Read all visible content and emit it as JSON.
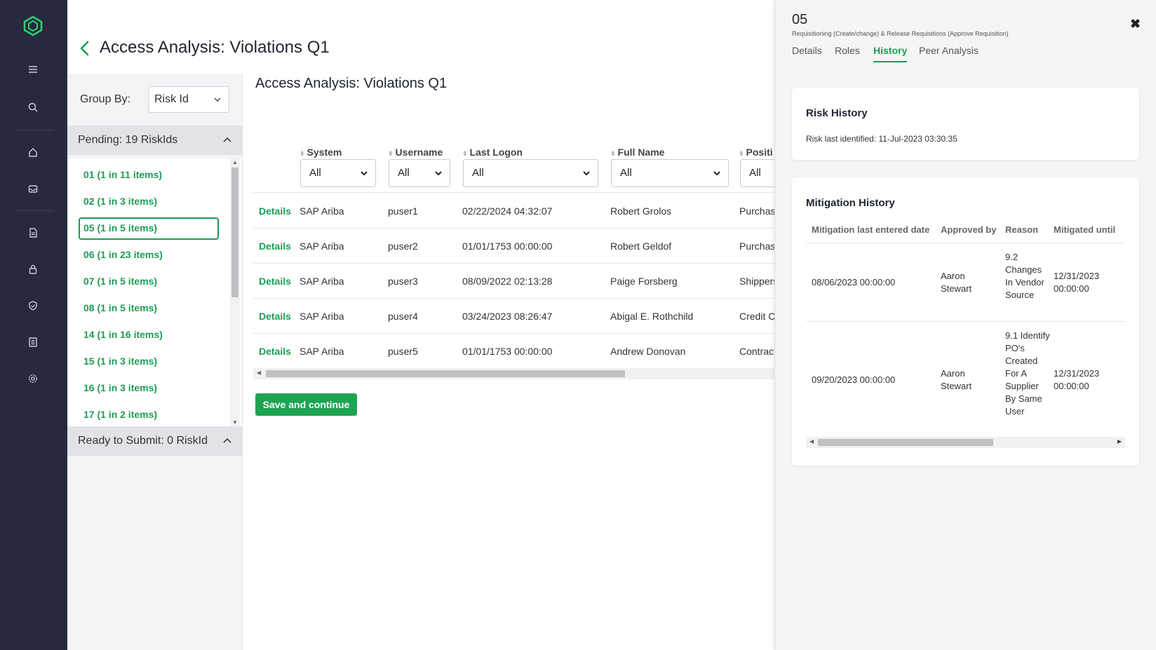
{
  "app": {
    "page_title": "Access Analysis: Violations Q1",
    "nav_icons": [
      "logo-icon",
      "menu-icon",
      "search-icon",
      "home-icon",
      "inbox-icon",
      "document-icon",
      "lock-icon",
      "shield-icon",
      "list-icon",
      "settings-icon"
    ]
  },
  "groupby": {
    "label": "Group By:",
    "selected": "Risk Id"
  },
  "pending": {
    "label": "Pending: 19 RiskIds",
    "items": [
      "01 (1 in 11 items)",
      "02 (1 in 3 items)",
      "05 (1 in 5 items)",
      "06 (1 in 23 items)",
      "07 (1 in 5 items)",
      "08 (1 in 5 items)",
      "14 (1 in 16 items)",
      "15 (1 in 3 items)",
      "16 (1 in 3 items)",
      "17 (1 in 2 items)"
    ],
    "selected_index": 2
  },
  "ready": {
    "label": "Ready to Submit: 0 RiskId"
  },
  "main": {
    "title": "Access Analysis: Violations Q1",
    "columns": [
      "System",
      "Username",
      "Last Logon",
      "Full Name",
      "Positi"
    ],
    "filter_value": "All",
    "details_label": "Details",
    "rows": [
      {
        "system": "SAP Ariba",
        "username": "puser1",
        "last_logon": "02/22/2024 04:32:07",
        "full_name": "Robert Grolos",
        "position": "Purchasi"
      },
      {
        "system": "SAP Ariba",
        "username": "puser2",
        "last_logon": "01/01/1753 00:00:00",
        "full_name": "Robert Geldof",
        "position": "Purchasi"
      },
      {
        "system": "SAP Ariba",
        "username": "puser3",
        "last_logon": "08/09/2022 02:13:28",
        "full_name": "Paige Forsberg",
        "position": "Shippers"
      },
      {
        "system": "SAP Ariba",
        "username": "puser4",
        "last_logon": "03/24/2023 08:26:47",
        "full_name": "Abigal E. Rothchild",
        "position": "Credit C"
      },
      {
        "system": "SAP Ariba",
        "username": "puser5",
        "last_logon": "01/01/1753 00:00:00",
        "full_name": "Andrew Donovan",
        "position": "Contract"
      }
    ],
    "save_label": "Save and continue"
  },
  "drawer": {
    "id": "05",
    "subtitle": "Requisitioning (Create/change) & Release Requisitions (Approve Requisition)",
    "close": "✖",
    "tabs": [
      "Details",
      "Roles",
      "History",
      "Peer Analysis"
    ],
    "active_tab": "History",
    "risk_history": {
      "title": "Risk History",
      "text": "Risk last identified: 11-Jul-2023 03:30:35"
    },
    "mitigation_history": {
      "title": "Mitigation History",
      "columns": [
        "Mitigation last entered date",
        "Approved by",
        "Reason",
        "Mitigated until"
      ],
      "rows": [
        {
          "date": "08/06/2023 00:00:00",
          "approved_by": "Aaron Stewart",
          "reason": "9.2 Changes In Vendor Source",
          "until": "12/31/2023 00:00:00"
        },
        {
          "date": "09/20/2023 00:00:00",
          "approved_by": "Aaron Stewart",
          "reason": "9.1 Identify PO's Created For A Supplier By Same User",
          "until": "12/31/2023 00:00:00"
        }
      ]
    }
  },
  "colors": {
    "accent": "#1d9d54",
    "nav_bg": "#27293f",
    "button": "#1da453"
  }
}
